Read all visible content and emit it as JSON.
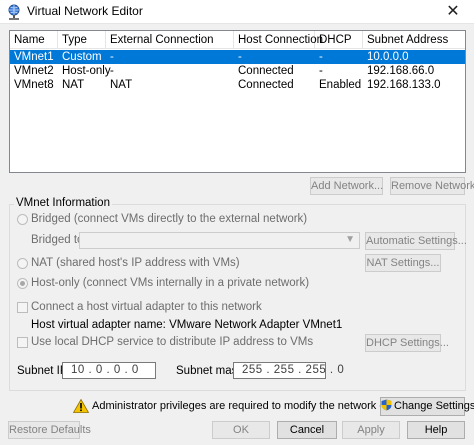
{
  "window": {
    "title": "Virtual Network Editor",
    "close_glyph": "✕"
  },
  "networks_table": {
    "columns": [
      "Name",
      "Type",
      "External Connection",
      "Host Connection",
      "DHCP",
      "Subnet Address"
    ],
    "rows": [
      {
        "name": "VMnet1",
        "type": "Custom",
        "external": "-",
        "host": "-",
        "dhcp": "-",
        "subnet": "10.0.0.0",
        "selected": true
      },
      {
        "name": "VMnet2",
        "type": "Host-only",
        "external": "-",
        "host": "Connected",
        "dhcp": "-",
        "subnet": "192.168.66.0",
        "selected": false
      },
      {
        "name": "VMnet8",
        "type": "NAT",
        "external": "NAT",
        "host": "Connected",
        "dhcp": "Enabled",
        "subnet": "192.168.133.0",
        "selected": false
      }
    ]
  },
  "list_buttons": {
    "add_network": "Add Network...",
    "remove_network": "Remove Network"
  },
  "vmnet_info": {
    "group_label": "VMnet Information",
    "bridged_label": "Bridged (connect VMs directly to the external network)",
    "bridged_to_label": "Bridged to:",
    "bridged_to_value": "",
    "automatic_settings": "Automatic Settings...",
    "nat_label": "NAT (shared host's IP address with VMs)",
    "nat_settings": "NAT Settings...",
    "hostonly_label": "Host-only (connect VMs internally in a private network)",
    "selected_mode": "host-only",
    "connect_adapter_label": "Connect a host virtual adapter to this network",
    "connect_adapter_checked": false,
    "adapter_name_label": "Host virtual adapter name: VMware Network Adapter VMnet1",
    "dhcp_label": "Use local DHCP service to distribute IP address to VMs",
    "dhcp_checked": false,
    "dhcp_settings": "DHCP Settings...",
    "subnet_ip_label": "Subnet IP:",
    "subnet_ip_value": "10 .  0  .  0  .  0",
    "subnet_mask_label": "Subnet mask:",
    "subnet_mask_value": "255 . 255 . 255 .  0"
  },
  "admin_notice": {
    "text": "Administrator privileges are required to modify the network configuration.",
    "change_settings": "Change Settings"
  },
  "footer_buttons": {
    "restore_defaults": "Restore Defaults",
    "ok": "OK",
    "cancel": "Cancel",
    "apply": "Apply",
    "help": "Help"
  },
  "colors": {
    "selection": "#0078d7",
    "window_bg": "#f0f0f0",
    "warning": "#f5c400"
  },
  "icons": {
    "app": "network-globe-icon",
    "warning": "warning-triangle-icon",
    "shield": "uac-shield-icon",
    "dropdown": "chevron-down-icon"
  }
}
